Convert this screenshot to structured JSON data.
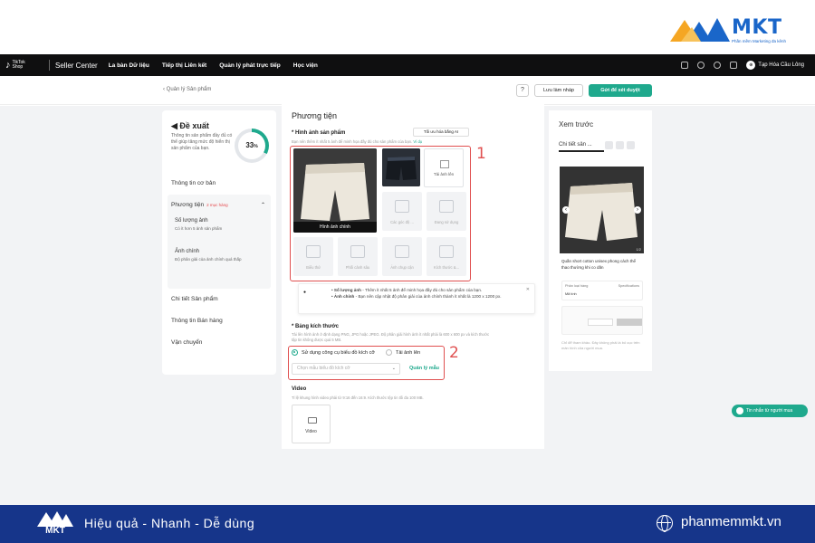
{
  "brand": {
    "name": "MKT",
    "tagline": "Phần mềm Marketing đa kênh",
    "colors": {
      "blue": "#1a66c9",
      "orange": "#f5a623"
    }
  },
  "topbar": {
    "logo_line1": "TikTok",
    "logo_line2": "Shop",
    "title": "Seller Center",
    "nav": [
      "La bàn Dữ liệu",
      "Tiếp thị Liên kết",
      "Quản lý phát trực tiếp",
      "Học viện"
    ],
    "user_name": "Tạp Hóa Cầu Lông"
  },
  "subbar": {
    "back": "‹ Quản lý Sản phẩm",
    "help": "?",
    "draft": "Lưu làm nháp",
    "submit": "Gửi để xét duyệt"
  },
  "left": {
    "suggest_title": "Đề xuất",
    "suggest_desc": "Thông tin sản phẩm đầy đủ có thể giúp tăng mức độ hiển thị sản phẩm của bạn.",
    "score": "33",
    "score_unit": "%",
    "basic": "Thông tin cơ bản",
    "media": "Phương tiện",
    "media_badge": "2 mục hàng",
    "qty_title": "Số lượng ảnh",
    "qty_desc": "Có ít hơn 5 ảnh sản phẩm",
    "main_img_title": "Ảnh chính",
    "main_img_desc": "Độ phân giải của ảnh chính quá thấp",
    "product_detail": "Chi tiết Sản phẩm",
    "sales_info": "Thông tin Bán hàng",
    "shipping": "Vận chuyển"
  },
  "mid": {
    "title": "Phương tiện",
    "images_title": "* Hình ảnh sản phẩm",
    "images_desc": "Bạn nên thêm ít nhất 5 ảnh để minh họa đầy đủ cho sản phẩm của bạn.",
    "images_desc_link": "Ví dụ",
    "ai_btn": "Tối ưu hóa bằng AI",
    "main_caption": "Hình ảnh chính",
    "upload": "Tải ảnh lên",
    "tiles": [
      "Các góc độ ...",
      "Đang sử dụng",
      "Biểu thứ",
      "Phối cảnh sâu",
      "Ảnh chụp cận",
      "Kích thước &..."
    ],
    "info_qty_label": "Số lượng ảnh",
    "info_qty_text": " - Thêm ít nhất 5 ảnh để minh họa đầy đủ cho sản phẩm của bạn.",
    "info_main_label": "Ảnh chính",
    "info_main_text": " - Bạn nên cập nhật độ phân giải của ảnh chính thành ít nhất là 1200 x 1200 px.",
    "size_title": "* Bảng kích thước",
    "size_desc1": "Tải lên hình ảnh ở định dạng PNG, JPG hoặc JPEG. Độ phân giải hình ảnh ít nhất phải là 600 x 600 px và kích thước",
    "size_desc2": "tập tin không được quá 5 MB.",
    "radio_tool": "Sử dụng công cụ biểu đồ kích cỡ",
    "radio_upload": "Tải ảnh lên",
    "select_placeholder": "Chọn mẫu biểu đồ kích cỡ",
    "manage": "Quản lý mẫu",
    "video_title": "Video",
    "video_desc": "Tỉ lệ khung hình video phải từ 9:16 đến 16:9. Kích thước tệp tin tối đa 100 MB.",
    "video_label": "Video",
    "marker1": "1",
    "marker2": "2"
  },
  "preview": {
    "title": "Xem trước",
    "tab": "Chi tiết sản ...",
    "count": "1/2",
    "product_name": "Quần short cotton unisex phong cách thể thao thường khi co dãn",
    "card1_label": "Phân loại hàng",
    "card1_right": "Specifications",
    "card1_value": "Mã tính",
    "note": "Chỉ để tham khảo. Đây không phải là bố cục trên màn hình của người mua."
  },
  "chat": "Tin nhắn từ người mua",
  "banner": {
    "logo": "MKT",
    "slogan": "Hiệu quả - Nhanh - Dễ dùng",
    "site": "phanmemmkt.vn"
  }
}
